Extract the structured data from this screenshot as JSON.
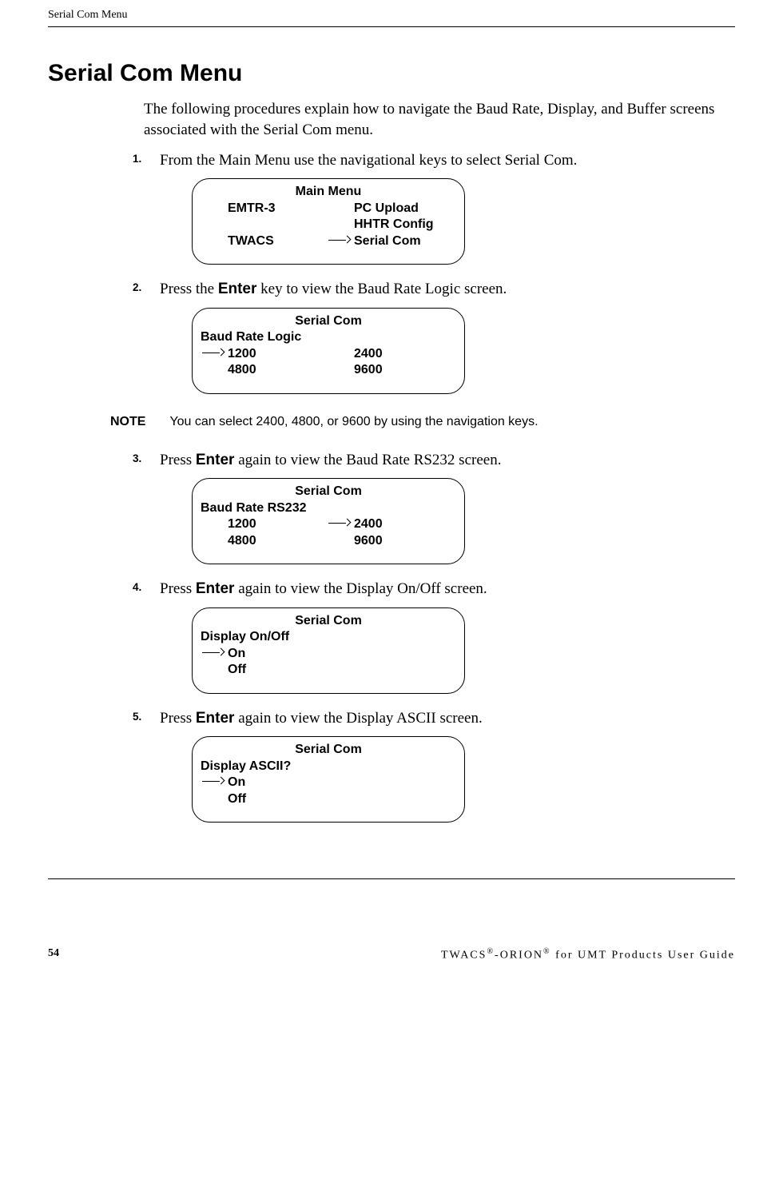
{
  "running_head": "Serial Com Menu",
  "title": "Serial Com Menu",
  "intro": "The following procedures explain how to navigate the Baud Rate, Display, and Buffer screens associated with the Serial Com menu.",
  "steps": {
    "s1_num": "1.",
    "s1_text": "From the Main Menu use the navigational keys to select Serial Com.",
    "s2_num": "2.",
    "s2_text_a": "Press the ",
    "s2_text_b": "Enter",
    "s2_text_c": " key to view the Baud Rate Logic screen.",
    "s3_num": "3.",
    "s3_text_a": "Press ",
    "s3_text_b": "Enter",
    "s3_text_c": " again to view the Baud Rate RS232 screen.",
    "s4_num": "4.",
    "s4_text_a": "Press ",
    "s4_text_b": "Enter",
    "s4_text_c": " again to view the Display On/Off screen.",
    "s5_num": "5.",
    "s5_text_a": "Press ",
    "s5_text_b": "Enter",
    "s5_text_c": " again to view the Display ASCII screen."
  },
  "note_label": "NOTE",
  "note_text": "You can select 2400, 4800, or 9600 by using the navigation keys.",
  "lcd1": {
    "title": "Main Menu",
    "r1c1": "EMTR-3",
    "r1c2": "PC Upload",
    "r2c1": "",
    "r2c2": "HHTR Config",
    "r3c1": "TWACS",
    "r3c2": "Serial Com"
  },
  "lcd2": {
    "title": "Serial Com",
    "sub": "Baud Rate Logic",
    "r1c1": "1200",
    "r1c2": "2400",
    "r2c1": "4800",
    "r2c2": "9600"
  },
  "lcd3": {
    "title": "Serial Com",
    "sub": "Baud Rate RS232",
    "r1c1": "1200",
    "r1c2": "2400",
    "r2c1": "4800",
    "r2c2": "9600"
  },
  "lcd4": {
    "title": "Serial Com",
    "sub": "Display On/Off",
    "r1c1": "On",
    "r2c1": "Off"
  },
  "lcd5": {
    "title": "Serial Com",
    "sub": "Display ASCII?",
    "r1c1": "On",
    "r2c1": "Off"
  },
  "footer": {
    "page_num": "54",
    "text_a": "TWACS",
    "text_b": "-ORION",
    "text_c": " for UMT Products User Guide",
    "reg": "®"
  }
}
